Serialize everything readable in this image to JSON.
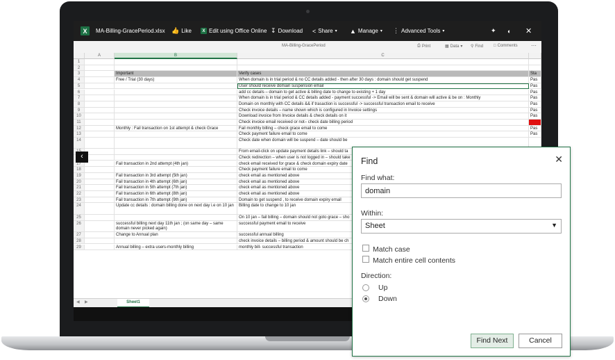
{
  "topbar": {
    "file_name": "MA-Billing-GracePeriod.xlsx",
    "like": "Like",
    "edit": "Edit using Office Online",
    "download": "Download",
    "share": "Share",
    "manage": "Manage",
    "advanced": "Advanced Tools"
  },
  "subbar": {
    "title": "MA-Billing-GracePeriod",
    "print": "Print",
    "data": "Data",
    "find": "Find",
    "comments": "Comments"
  },
  "columns": [
    "A",
    "B",
    "C"
  ],
  "rows": [
    {
      "n": "1",
      "b": "",
      "c": "",
      "d": ""
    },
    {
      "n": "2",
      "b": "",
      "c": "",
      "d": ""
    },
    {
      "n": "3",
      "b": "Important",
      "c": "Verify cases",
      "d": "Sta"
    },
    {
      "n": "4",
      "b": "Free / Trial (30 days)",
      "c": "When domain is in trial period & no CC details added - then after 30 days : domain should get suspend",
      "d": "Pas"
    },
    {
      "n": "5",
      "b": "",
      "c": "User should receive domain suspension email",
      "d": "Pas"
    },
    {
      "n": "6",
      "b": "",
      "c": "add cc details – domain to get active & billing date to change to existing + 1 day",
      "d": "Pas"
    },
    {
      "n": "7",
      "b": "",
      "c": "When domain is in trial period & CC details added - payment successful -> Email will be sent & domain will active & be on : Monthly",
      "d": "Pas"
    },
    {
      "n": "8",
      "b": "",
      "c": "Domain on monthly with CC details && if trasaction is successful -> successful transaction email to receive",
      "d": "Pas"
    },
    {
      "n": "9",
      "b": "",
      "c": "Check invoice details – name shown which is configured in Invoice settings",
      "d": "Pas"
    },
    {
      "n": "10",
      "b": "",
      "c": "Download invoice from Invoice details & check details on it",
      "d": "Pas"
    },
    {
      "n": "11",
      "b": "",
      "c": "Check invoice email received or not– check date billing period",
      "d": ""
    },
    {
      "n": "12",
      "b": "Monthly : Fail transaction on 1st attempt & check Grace",
      "c": "Fail monthly billing – check grace email to come",
      "d": "Pas"
    },
    {
      "n": "13",
      "b": "",
      "c": "Check payment failure email to come",
      "d": "Pas"
    },
    {
      "n": "14",
      "b": "",
      "c": "Check date when domain will be suspend –  date should be",
      "d": ""
    },
    {
      "n": "15",
      "b": "",
      "c": "From email-click on update payment details link – should ta",
      "d": ""
    },
    {
      "n": "16",
      "b": "",
      "c": "Check redirection – when user is not logged in – should take",
      "d": ""
    },
    {
      "n": "17",
      "b": "Fail transaction in 2nd attempt (4th jan)",
      "c": "check email received for grace & check domain expiry date",
      "d": ""
    },
    {
      "n": "18",
      "b": "",
      "c": "Check payment failure email to come",
      "d": ""
    },
    {
      "n": "19",
      "b": "Fail transaction in 3rd attempt (5th jan)",
      "c": "check email as mentioned above",
      "d": ""
    },
    {
      "n": "20",
      "b": "Fail transaction in 4th attempt (6th jan)",
      "c": "check email as mentioned above",
      "d": ""
    },
    {
      "n": "21",
      "b": "Fail transaction in 5th attempt (7th jan)",
      "c": "check email as mentioned above",
      "d": ""
    },
    {
      "n": "22",
      "b": "Fail transaction in 6th attempt (8th jan)",
      "c": "check email as mentioned above",
      "d": ""
    },
    {
      "n": "23",
      "b": "Fail transaction in 7th attempt (9th jan)",
      "c": "Domain to get suspend , to receive domain expiry email",
      "d": ""
    },
    {
      "n": "24",
      "b": "Update cc details : domain billing done on next day i.e on 10 jan",
      "c": "Billing date to change to 10 jan",
      "d": ""
    },
    {
      "n": "25",
      "b": "",
      "c": "On 10 jan – fail billing – domain should not goto grace – sho",
      "d": ""
    },
    {
      "n": "26",
      "b": "successful billing next day 11th jan ; (on same day – same domain never picked again)",
      "c": "successful payment email to receive",
      "d": ""
    },
    {
      "n": "27",
      "b": "Change to Annual plan",
      "c": "successful annual billing",
      "d": ""
    },
    {
      "n": "28",
      "b": "",
      "c": "check invoice details – billing period & amount should be ch",
      "d": ""
    },
    {
      "n": "29",
      "b": "Annual billing – extra users-monthly billing",
      "c": "monthly bill- successful transaction",
      "d": ""
    }
  ],
  "sheet_tab": "Sheet1",
  "find_dialog": {
    "title": "Find",
    "find_what_label": "Find what:",
    "find_what_value": "domain",
    "within_label": "Within:",
    "within_value": "Sheet",
    "match_case": "Match case",
    "match_entire": "Match entire cell contents",
    "direction_label": "Direction:",
    "up": "Up",
    "down": "Down",
    "find_next": "Find Next",
    "cancel": "Cancel"
  },
  "colors": {
    "accent": "#217346",
    "failed": "#e01010"
  }
}
